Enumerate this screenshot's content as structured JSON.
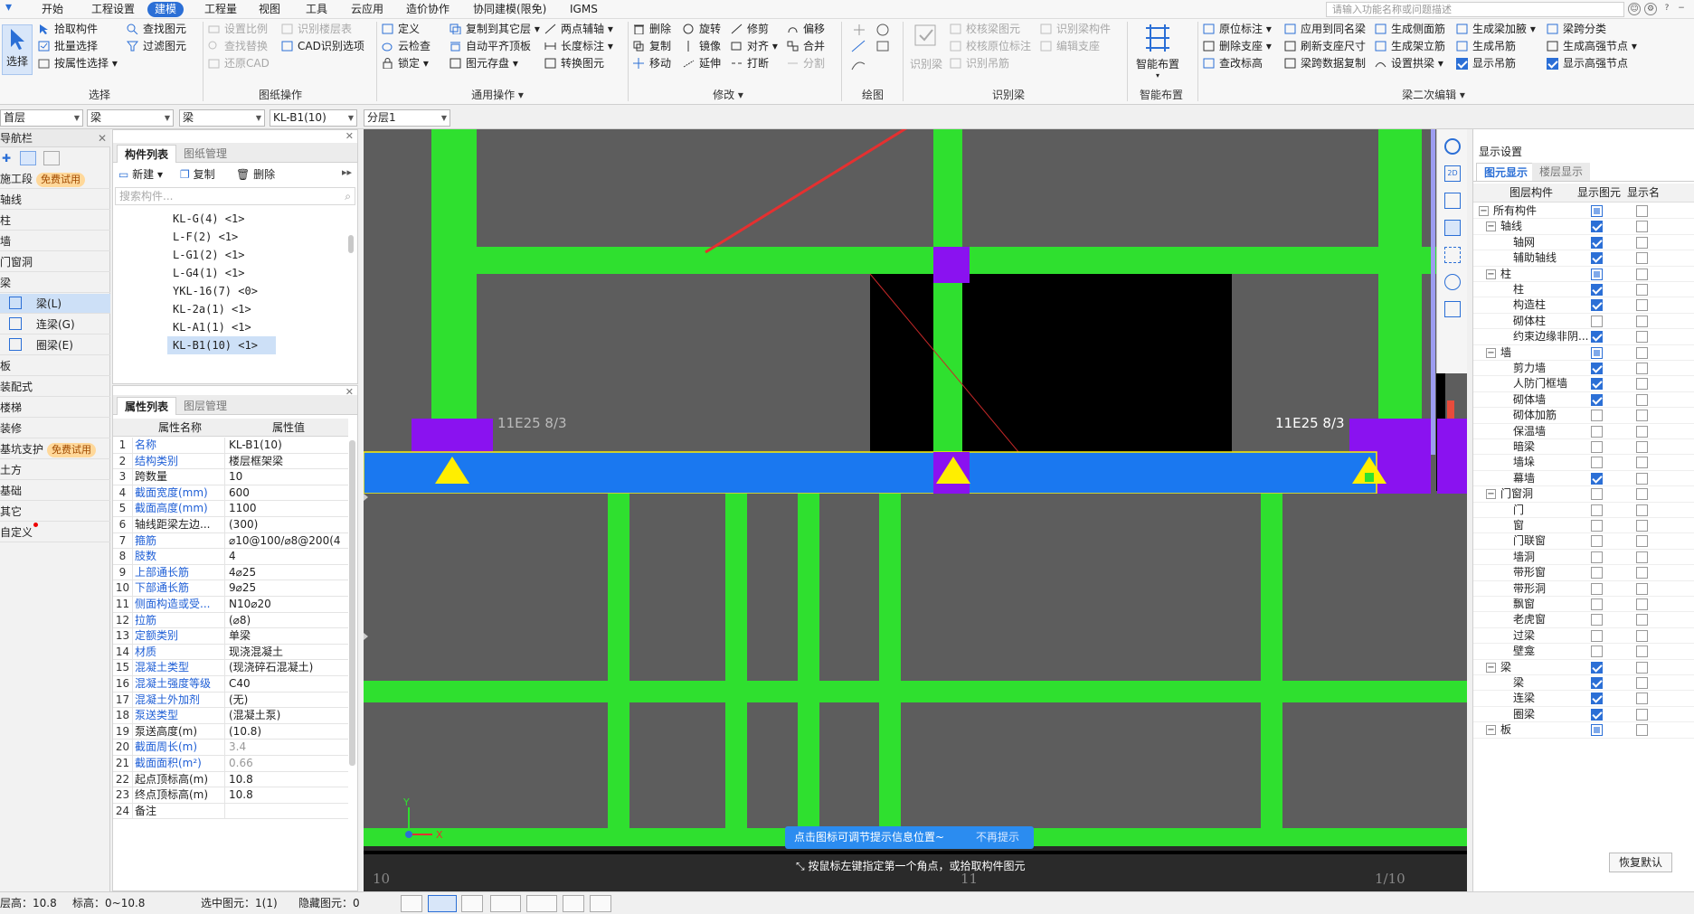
{
  "menu": {
    "items": [
      "开始",
      "工程设置",
      "建模",
      "工程量",
      "视图",
      "工具",
      "云应用",
      "造价协作",
      "协同建模(限免)",
      "IGMS"
    ],
    "active_index": 2,
    "search_placeholder": "请输入功能名称或问题描述"
  },
  "ribbon": {
    "select_big": "选择",
    "select": {
      "pick": "拾取构件",
      "batch": "批量选择",
      "by_attr": "按属性选择",
      "find": "查找图元",
      "filter": "过滤图元",
      "group": "选择"
    },
    "drawing_ops": {
      "set_ratio": "设置比例",
      "identify_floor": "识别楼层表",
      "find_replace": "查找替换",
      "cad_options": "CAD识别选项",
      "restore_cad": "还原CAD",
      "group": "图纸操作"
    },
    "general_ops": {
      "define": "定义",
      "copy_to_floor": "复制到其它层",
      "two_point_axis": "两点辅轴",
      "cloud_check": "云检查",
      "auto_flush_top": "自动平齐顶板",
      "length_mark": "长度标注",
      "lock": "锁定",
      "store_drawing": "图元存盘",
      "convert": "转换图元",
      "group": "通用操作"
    },
    "modify": {
      "delete": "删除",
      "rotate": "旋转",
      "trim": "修剪",
      "offset": "偏移",
      "copy": "复制",
      "mirror": "镜像",
      "align": "对齐",
      "merge": "合并",
      "move": "移动",
      "extend": "延伸",
      "break": "打断",
      "split": "分割",
      "group": "修改"
    },
    "draw_group": "绘图",
    "identify_beam": {
      "big": "识别梁",
      "check_beam": "校核梁图元",
      "check_mark": "校核原位标注",
      "identify_hanger": "识别吊筋",
      "identify_beam_comp": "识别梁构件",
      "edit_support": "编辑支座",
      "group": "识别梁"
    },
    "smart": {
      "big": "智能布置",
      "group": "智能布置"
    },
    "beam_edit": {
      "in_place_mark": "原位标注",
      "apply_same_name": "应用到同名梁",
      "gen_side_rebar": "生成侧面筋",
      "gen_extra_stirrup": "生成梁加腋",
      "beam_span_class": "梁跨分类",
      "delete_support": "删除支座",
      "refresh_support": "刷新支座尺寸",
      "gen_stand_bar": "生成架立筋",
      "gen_hanger": "生成吊筋",
      "gen_haunch_node": "生成高强节点",
      "view_mark": "查改标高",
      "span_copy": "梁跨数据复制",
      "set_arch": "设置拱梁",
      "show_hanger": "显示吊筋",
      "show_haunch_node": "显示高强节点",
      "group": "梁二次编辑"
    }
  },
  "selectors": {
    "floor": "首层",
    "type": "梁",
    "sub": "梁",
    "component": "KL-B1(10)",
    "layer": "分层1"
  },
  "leftnav": {
    "title": "导航栏",
    "items": [
      {
        "label": "施工段",
        "badge": "免费试用"
      },
      {
        "label": "轴线"
      },
      {
        "label": "柱"
      },
      {
        "label": "墙"
      },
      {
        "label": "门窗洞"
      },
      {
        "label": "梁"
      },
      {
        "label": "梁(L)",
        "sub": true,
        "selected": true
      },
      {
        "label": "连梁(G)",
        "sub": true
      },
      {
        "label": "圈梁(E)",
        "sub": true
      },
      {
        "label": "板"
      },
      {
        "label": "装配式"
      },
      {
        "label": "楼梯"
      },
      {
        "label": "装修"
      },
      {
        "label": "基坑支护",
        "badge": "免费试用"
      },
      {
        "label": "土方"
      },
      {
        "label": "基础"
      },
      {
        "label": "其它"
      },
      {
        "label": "自定义",
        "dot": true
      }
    ]
  },
  "component_panel": {
    "tabs": [
      "构件列表",
      "图纸管理"
    ],
    "new": "新建",
    "copy": "复制",
    "delete": "删除",
    "search_placeholder": "搜索构件...",
    "items": [
      "KL-G(4) <1>",
      "L-F(2) <1>",
      "L-G1(2) <1>",
      "L-G4(1) <1>",
      "YKL-16(7) <0>",
      "KL-2a(1) <1>",
      "KL-A1(1) <1>",
      "KL-B1(10) <1>"
    ],
    "selected_index": 7
  },
  "property_panel": {
    "tabs": [
      "属性列表",
      "图层管理"
    ],
    "col_name": "属性名称",
    "col_value": "属性值",
    "rows": [
      {
        "n": "1",
        "k": "名称",
        "v": "KL-B1(10)",
        "blue": true
      },
      {
        "n": "2",
        "k": "结构类别",
        "v": "楼层框架梁",
        "blue": true
      },
      {
        "n": "3",
        "k": "跨数量",
        "v": "10"
      },
      {
        "n": "4",
        "k": "截面宽度(mm)",
        "v": "600",
        "blue": true
      },
      {
        "n": "5",
        "k": "截面高度(mm)",
        "v": "1100",
        "blue": true
      },
      {
        "n": "6",
        "k": "轴线距梁左边...",
        "v": "(300)"
      },
      {
        "n": "7",
        "k": "箍筋",
        "v": "⌀10@100/⌀8@200(4",
        "blue": true
      },
      {
        "n": "8",
        "k": "肢数",
        "v": "4",
        "blue": true
      },
      {
        "n": "9",
        "k": "上部通长筋",
        "v": "4⌀25",
        "blue": true
      },
      {
        "n": "10",
        "k": "下部通长筋",
        "v": "9⌀25",
        "blue": true
      },
      {
        "n": "11",
        "k": "侧面构造或受...",
        "v": "N10⌀20",
        "blue": true
      },
      {
        "n": "12",
        "k": "拉筋",
        "v": "(⌀8)",
        "blue": true
      },
      {
        "n": "13",
        "k": "定额类别",
        "v": "单梁",
        "blue": true
      },
      {
        "n": "14",
        "k": "材质",
        "v": "现浇混凝土",
        "blue": true
      },
      {
        "n": "15",
        "k": "混凝土类型",
        "v": "(现浇碎石混凝土)",
        "blue": true
      },
      {
        "n": "16",
        "k": "混凝土强度等级",
        "v": "C40",
        "blue": true
      },
      {
        "n": "17",
        "k": "混凝土外加剂",
        "v": "(无)",
        "blue": true
      },
      {
        "n": "18",
        "k": "泵送类型",
        "v": "(混凝土泵)",
        "blue": true
      },
      {
        "n": "19",
        "k": "泵送高度(m)",
        "v": "(10.8)"
      },
      {
        "n": "20",
        "k": "截面周长(m)",
        "v": "3.4",
        "blue": true,
        "grey": true
      },
      {
        "n": "21",
        "k": "截面面积(m²)",
        "v": "0.66",
        "blue": true,
        "grey": true
      },
      {
        "n": "22",
        "k": "起点顶标高(m)",
        "v": "10.8"
      },
      {
        "n": "23",
        "k": "终点顶标高(m)",
        "v": "10.8"
      },
      {
        "n": "24",
        "k": "备注",
        "v": ""
      }
    ]
  },
  "canvas": {
    "label_left": "11E25 8/3",
    "label_right": "11E25 8/3",
    "axis_labels": [
      "10",
      "11",
      "1/10"
    ],
    "axis_x": "X",
    "axis_y": "Y",
    "tip_text": "点击图标可调节提示信息位置~",
    "tip_dismiss": "不再提示",
    "prompt": "按鼠标左键指定第一个角点，或拾取构件图元",
    "colors": {
      "bg": "#5d5d5d",
      "green": "#2fe02f",
      "blue": "#1a78f0",
      "purple": "#8a12f0",
      "yellow": "#ffee00",
      "black": "#000000",
      "arrow": "#e53030"
    }
  },
  "display": {
    "title": "显示设置",
    "tabs": [
      "图元显示",
      "楼层显示"
    ],
    "col_component": "图层构件",
    "col_show": "显示图元",
    "col_name": "显示名",
    "restore": "恢复默认",
    "rows": [
      {
        "label": "所有构件",
        "level": 0,
        "toggle": "−",
        "show": "part",
        "name": false
      },
      {
        "label": "轴线",
        "level": 1,
        "toggle": "−",
        "show": "on",
        "name": false
      },
      {
        "label": "轴网",
        "level": 2,
        "show": "on",
        "name": false
      },
      {
        "label": "辅助轴线",
        "level": 2,
        "show": "on",
        "name": false
      },
      {
        "label": "柱",
        "level": 1,
        "toggle": "−",
        "show": "part",
        "name": false
      },
      {
        "label": "柱",
        "level": 2,
        "show": "on",
        "name": false
      },
      {
        "label": "构造柱",
        "level": 2,
        "show": "on",
        "name": false
      },
      {
        "label": "砌体柱",
        "level": 2,
        "show": "off",
        "name": false
      },
      {
        "label": "约束边缘非阴...",
        "level": 2,
        "show": "on",
        "name": false
      },
      {
        "label": "墙",
        "level": 1,
        "toggle": "−",
        "show": "part",
        "name": false
      },
      {
        "label": "剪力墙",
        "level": 2,
        "show": "on",
        "name": false
      },
      {
        "label": "人防门框墙",
        "level": 2,
        "show": "on",
        "name": false
      },
      {
        "label": "砌体墙",
        "level": 2,
        "show": "on",
        "name": false
      },
      {
        "label": "砌体加筋",
        "level": 2,
        "show": "off",
        "name": false
      },
      {
        "label": "保温墙",
        "level": 2,
        "show": "off",
        "name": false
      },
      {
        "label": "暗梁",
        "level": 2,
        "show": "off",
        "name": false
      },
      {
        "label": "墙垛",
        "level": 2,
        "show": "off",
        "name": false
      },
      {
        "label": "幕墙",
        "level": 2,
        "show": "on",
        "name": false
      },
      {
        "label": "门窗洞",
        "level": 1,
        "toggle": "−",
        "show": "off",
        "name": false
      },
      {
        "label": "门",
        "level": 2,
        "show": "off",
        "name": false
      },
      {
        "label": "窗",
        "level": 2,
        "show": "off",
        "name": false
      },
      {
        "label": "门联窗",
        "level": 2,
        "show": "off",
        "name": false
      },
      {
        "label": "墙洞",
        "level": 2,
        "show": "off",
        "name": false
      },
      {
        "label": "带形窗",
        "level": 2,
        "show": "off",
        "name": false
      },
      {
        "label": "带形洞",
        "level": 2,
        "show": "off",
        "name": false
      },
      {
        "label": "飘窗",
        "level": 2,
        "show": "off",
        "name": false
      },
      {
        "label": "老虎窗",
        "level": 2,
        "show": "off",
        "name": false
      },
      {
        "label": "过梁",
        "level": 2,
        "show": "off",
        "name": false
      },
      {
        "label": "壁龛",
        "level": 2,
        "show": "off",
        "name": false
      },
      {
        "label": "梁",
        "level": 1,
        "toggle": "−",
        "show": "on",
        "name": false
      },
      {
        "label": "梁",
        "level": 2,
        "show": "on",
        "name": false
      },
      {
        "label": "连梁",
        "level": 2,
        "show": "on",
        "name": false
      },
      {
        "label": "圈梁",
        "level": 2,
        "show": "on",
        "name": false
      },
      {
        "label": "板",
        "level": 1,
        "toggle": "−",
        "show": "part",
        "name": false
      }
    ]
  },
  "status": {
    "floor_height": "层高：10.8",
    "elevation": "标高：0~10.8",
    "selected": "选中图元：1(1)",
    "hidden": "隐藏图元：0"
  }
}
